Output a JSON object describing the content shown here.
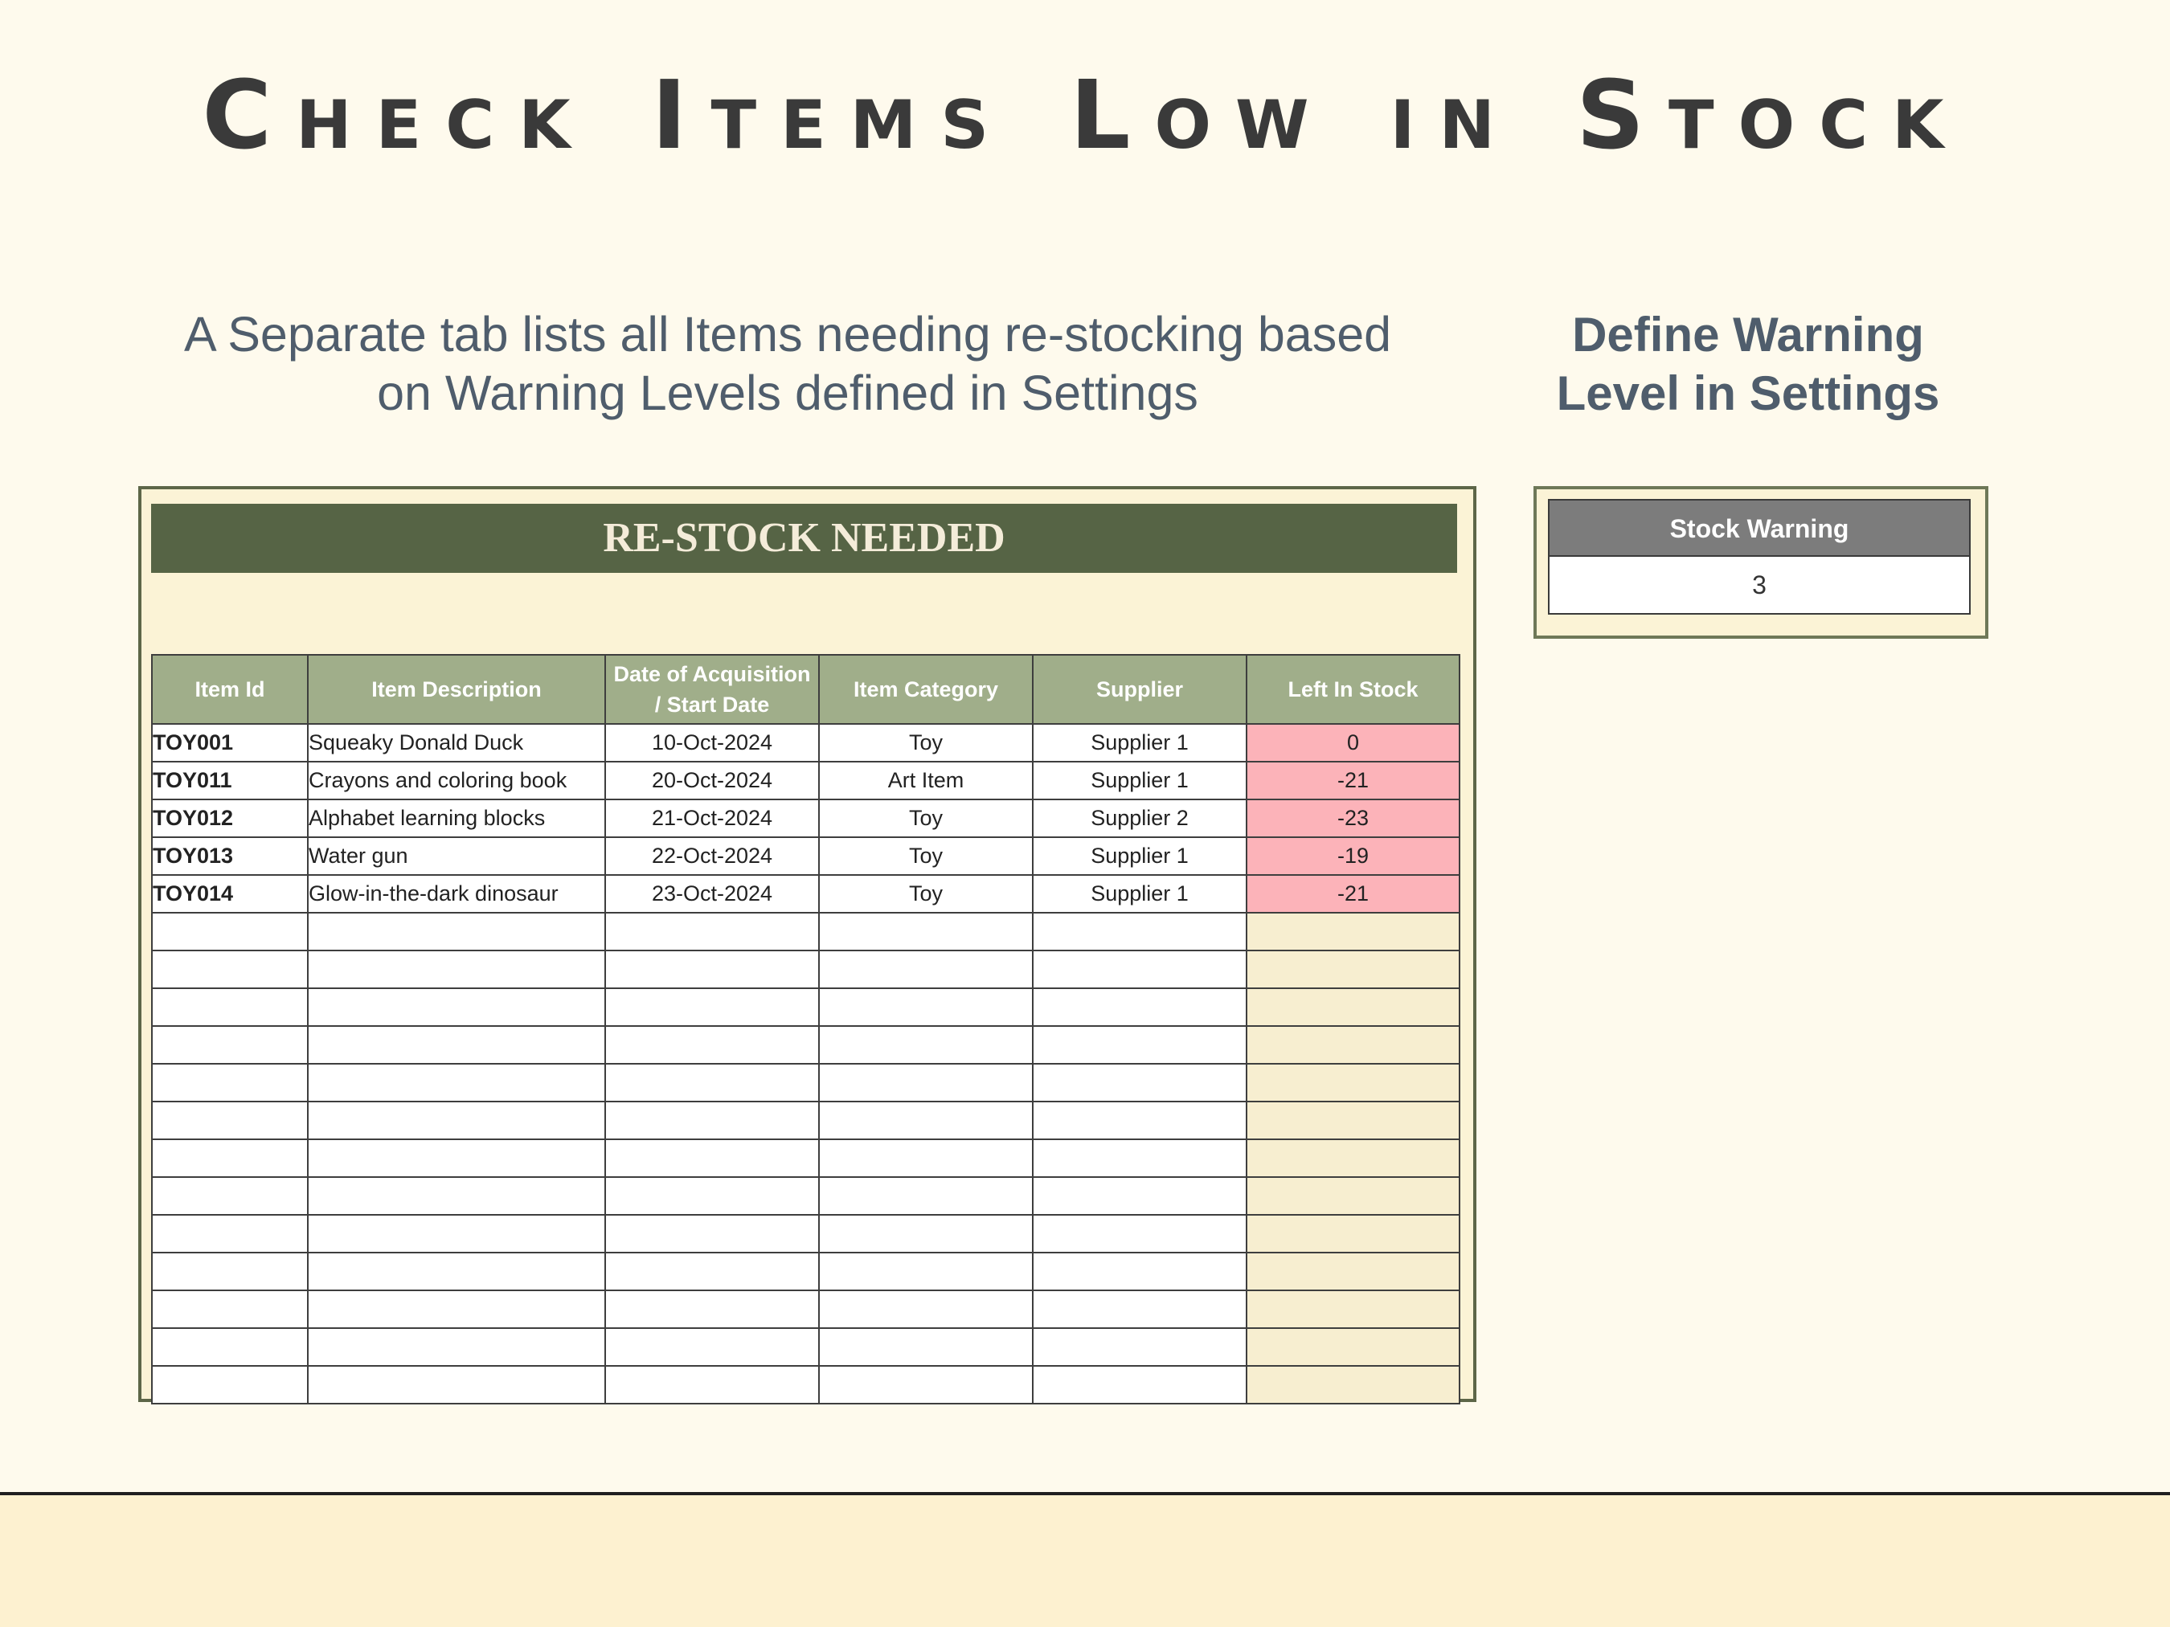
{
  "page": {
    "title": "Check Items Low in Stock",
    "subtitle_line1": "A Separate tab lists all Items needing re-stocking based",
    "subtitle_line2": "on Warning Levels defined in Settings",
    "side_heading_line1": "Define Warning",
    "side_heading_line2": "Level in Settings"
  },
  "sheet": {
    "banner": "RE-STOCK NEEDED",
    "headers": {
      "item_id": "Item Id",
      "item_description": "Item Description",
      "date_line1": "Date of Acquisition",
      "date_line2": "/ Start Date",
      "item_category": "Item Category",
      "supplier": "Supplier",
      "left_in_stock": "Left In Stock"
    },
    "rows": [
      {
        "id": "TOY001",
        "desc": "Squeaky Donald Duck",
        "date": "10-Oct-2024",
        "category": "Toy",
        "supplier": "Supplier 1",
        "stock": "0"
      },
      {
        "id": "TOY011",
        "desc": "Crayons and coloring book",
        "date": "20-Oct-2024",
        "category": "Art Item",
        "supplier": "Supplier 1",
        "stock": "-21"
      },
      {
        "id": "TOY012",
        "desc": "Alphabet learning blocks",
        "date": "21-Oct-2024",
        "category": "Toy",
        "supplier": "Supplier 2",
        "stock": "-23"
      },
      {
        "id": "TOY013",
        "desc": "Water gun",
        "date": "22-Oct-2024",
        "category": "Toy",
        "supplier": "Supplier 1",
        "stock": "-19"
      },
      {
        "id": "TOY014",
        "desc": "Glow-in-the-dark dinosaur",
        "date": "23-Oct-2024",
        "category": "Toy",
        "supplier": "Supplier 1",
        "stock": "-21"
      }
    ]
  },
  "settings": {
    "stock_warning_label": "Stock Warning",
    "stock_warning_value": "3"
  },
  "colors": {
    "banner": "#566445",
    "header": "#a0ae8a",
    "low_stock": "#fcb3b9",
    "supplier_column": "#f7eed0",
    "text": "#4f5d6c"
  }
}
